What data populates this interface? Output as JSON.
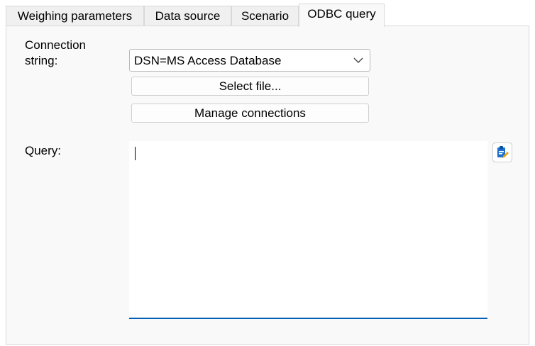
{
  "tabs": [
    {
      "label": "Weighing parameters",
      "active": false
    },
    {
      "label": "Data source",
      "active": false
    },
    {
      "label": "Scenario",
      "active": false
    },
    {
      "label": "ODBC query",
      "active": true
    }
  ],
  "connection": {
    "label_line1": "Connection",
    "label_line2": "string:",
    "selected_value": "DSN=MS Access Database"
  },
  "buttons": {
    "select_file": "Select file...",
    "manage_connections": "Manage connections"
  },
  "query": {
    "label": "Query:",
    "value": ""
  },
  "icons": {
    "query_builder": "clipboard-edit-icon",
    "dropdown": "chevron-down-icon"
  },
  "colors": {
    "accent": "#005fb8",
    "icon_blue": "#1a6fd1",
    "icon_pencil": "#e8a317"
  }
}
